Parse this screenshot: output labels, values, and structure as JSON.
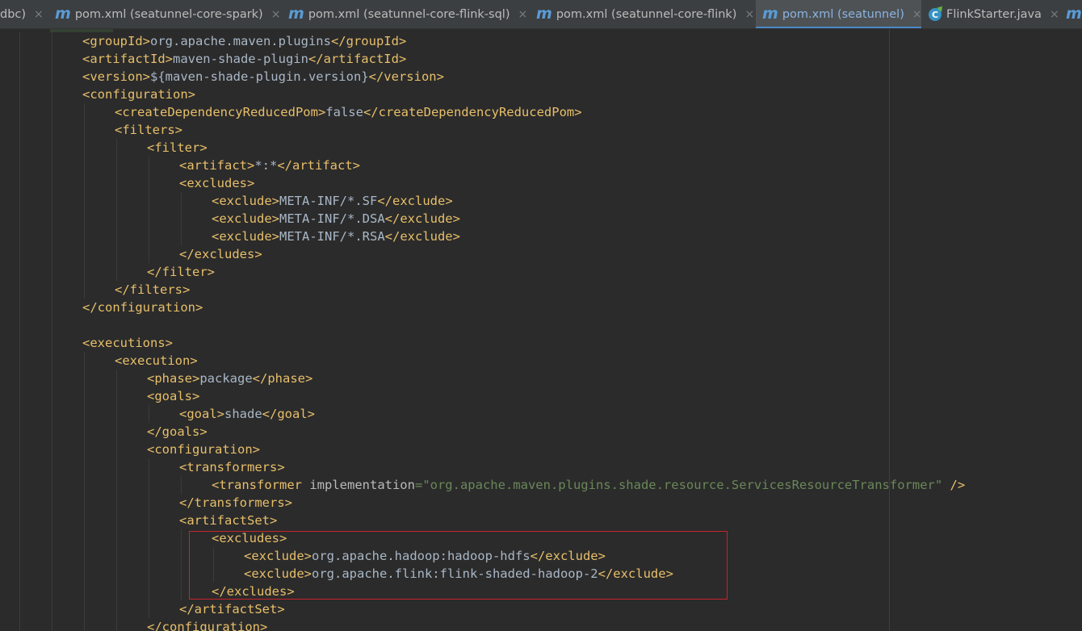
{
  "tabs": [
    {
      "label": "dbc)",
      "icon": "none",
      "active": false
    },
    {
      "label": "pom.xml (seatunnel-core-spark)",
      "icon": "maven-icon",
      "active": false
    },
    {
      "label": "pom.xml (seatunnel-core-flink-sql)",
      "icon": "maven-icon",
      "active": false
    },
    {
      "label": "pom.xml (seatunnel-core-flink)",
      "icon": "maven-icon",
      "active": false
    },
    {
      "label": "pom.xml (seatunnel)",
      "icon": "maven-icon",
      "active": true
    },
    {
      "label": "FlinkStarter.java",
      "icon": "java-class-icon",
      "active": false
    },
    {
      "label": "",
      "icon": "maven-icon",
      "active": false
    }
  ],
  "tab_glyphs": {
    "maven": "m",
    "java": "C",
    "close": "×"
  },
  "colors": {
    "background": "#2b2b2b",
    "tag": "#e8bf6a",
    "text": "#a9b7c6",
    "attribute": "#bababa",
    "string": "#6a8759",
    "active_tab_underline": "#4a88c7",
    "highlight_box": "#c8232b"
  },
  "code": [
    {
      "indent": 2,
      "parts": [
        {
          "t": "tag",
          "s": "<groupId>"
        },
        {
          "t": "txt",
          "s": "org.apache.maven.plugins"
        },
        {
          "t": "tag",
          "s": "</groupId>"
        }
      ]
    },
    {
      "indent": 2,
      "parts": [
        {
          "t": "tag",
          "s": "<artifactId>"
        },
        {
          "t": "txt",
          "s": "maven-shade-plugin"
        },
        {
          "t": "tag",
          "s": "</artifactId>"
        }
      ]
    },
    {
      "indent": 2,
      "parts": [
        {
          "t": "tag",
          "s": "<version>"
        },
        {
          "t": "txt",
          "s": "${maven-shade-plugin.version}"
        },
        {
          "t": "tag",
          "s": "</version>"
        }
      ]
    },
    {
      "indent": 2,
      "parts": [
        {
          "t": "tag",
          "s": "<configuration>"
        }
      ]
    },
    {
      "indent": 3,
      "parts": [
        {
          "t": "tag",
          "s": "<createDependencyReducedPom>"
        },
        {
          "t": "txt",
          "s": "false"
        },
        {
          "t": "tag",
          "s": "</createDependencyReducedPom>"
        }
      ]
    },
    {
      "indent": 3,
      "parts": [
        {
          "t": "tag",
          "s": "<filters>"
        }
      ]
    },
    {
      "indent": 4,
      "parts": [
        {
          "t": "tag",
          "s": "<filter>"
        }
      ]
    },
    {
      "indent": 5,
      "parts": [
        {
          "t": "tag",
          "s": "<artifact>"
        },
        {
          "t": "txt",
          "s": "*:*"
        },
        {
          "t": "tag",
          "s": "</artifact>"
        }
      ]
    },
    {
      "indent": 5,
      "parts": [
        {
          "t": "tag",
          "s": "<excludes>"
        }
      ]
    },
    {
      "indent": 6,
      "parts": [
        {
          "t": "tag",
          "s": "<exclude>"
        },
        {
          "t": "txt",
          "s": "META-INF/*.SF"
        },
        {
          "t": "tag",
          "s": "</exclude>"
        }
      ]
    },
    {
      "indent": 6,
      "parts": [
        {
          "t": "tag",
          "s": "<exclude>"
        },
        {
          "t": "txt",
          "s": "META-INF/*.DSA"
        },
        {
          "t": "tag",
          "s": "</exclude>"
        }
      ]
    },
    {
      "indent": 6,
      "parts": [
        {
          "t": "tag",
          "s": "<exclude>"
        },
        {
          "t": "txt",
          "s": "META-INF/*.RSA"
        },
        {
          "t": "tag",
          "s": "</exclude>"
        }
      ]
    },
    {
      "indent": 5,
      "parts": [
        {
          "t": "tag",
          "s": "</excludes>"
        }
      ]
    },
    {
      "indent": 4,
      "parts": [
        {
          "t": "tag",
          "s": "</filter>"
        }
      ]
    },
    {
      "indent": 3,
      "parts": [
        {
          "t": "tag",
          "s": "</filters>"
        }
      ]
    },
    {
      "indent": 2,
      "parts": [
        {
          "t": "tag",
          "s": "</configuration>"
        }
      ]
    },
    {
      "indent": 0,
      "parts": []
    },
    {
      "indent": 2,
      "parts": [
        {
          "t": "tag",
          "s": "<executions>"
        }
      ]
    },
    {
      "indent": 3,
      "parts": [
        {
          "t": "tag",
          "s": "<execution>"
        }
      ]
    },
    {
      "indent": 4,
      "parts": [
        {
          "t": "tag",
          "s": "<phase>"
        },
        {
          "t": "txt",
          "s": "package"
        },
        {
          "t": "tag",
          "s": "</phase>"
        }
      ]
    },
    {
      "indent": 4,
      "parts": [
        {
          "t": "tag",
          "s": "<goals>"
        }
      ]
    },
    {
      "indent": 5,
      "parts": [
        {
          "t": "tag",
          "s": "<goal>"
        },
        {
          "t": "txt",
          "s": "shade"
        },
        {
          "t": "tag",
          "s": "</goal>"
        }
      ]
    },
    {
      "indent": 4,
      "parts": [
        {
          "t": "tag",
          "s": "</goals>"
        }
      ]
    },
    {
      "indent": 4,
      "parts": [
        {
          "t": "tag",
          "s": "<configuration>"
        }
      ]
    },
    {
      "indent": 5,
      "parts": [
        {
          "t": "tag",
          "s": "<transformers>"
        }
      ]
    },
    {
      "indent": 6,
      "parts": [
        {
          "t": "tag",
          "s": "<transformer "
        },
        {
          "t": "attr",
          "s": "implementation"
        },
        {
          "t": "val",
          "s": "=\"org.apache.maven.plugins.shade.resource.ServicesResourceTransformer\""
        },
        {
          "t": "tag",
          "s": " />"
        }
      ]
    },
    {
      "indent": 5,
      "parts": [
        {
          "t": "tag",
          "s": "</transformers>"
        }
      ]
    },
    {
      "indent": 5,
      "parts": [
        {
          "t": "tag",
          "s": "<artifactSet>"
        }
      ]
    },
    {
      "indent": 6,
      "parts": [
        {
          "t": "tag",
          "s": "<excludes>"
        }
      ]
    },
    {
      "indent": 7,
      "parts": [
        {
          "t": "tag",
          "s": "<exclude>"
        },
        {
          "t": "txt",
          "s": "org.apache.hadoop:hadoop-hdfs"
        },
        {
          "t": "tag",
          "s": "</exclude>"
        }
      ]
    },
    {
      "indent": 7,
      "parts": [
        {
          "t": "tag",
          "s": "<exclude>"
        },
        {
          "t": "txt",
          "s": "org.apache.flink:flink-shaded-hadoop-2"
        },
        {
          "t": "tag",
          "s": "</exclude>"
        }
      ]
    },
    {
      "indent": 6,
      "parts": [
        {
          "t": "tag",
          "s": "</excludes>"
        }
      ]
    },
    {
      "indent": 5,
      "parts": [
        {
          "t": "tag",
          "s": "</artifactSet>"
        }
      ]
    },
    {
      "indent": 4,
      "parts": [
        {
          "t": "tag",
          "s": "</configuration>"
        }
      ]
    }
  ]
}
